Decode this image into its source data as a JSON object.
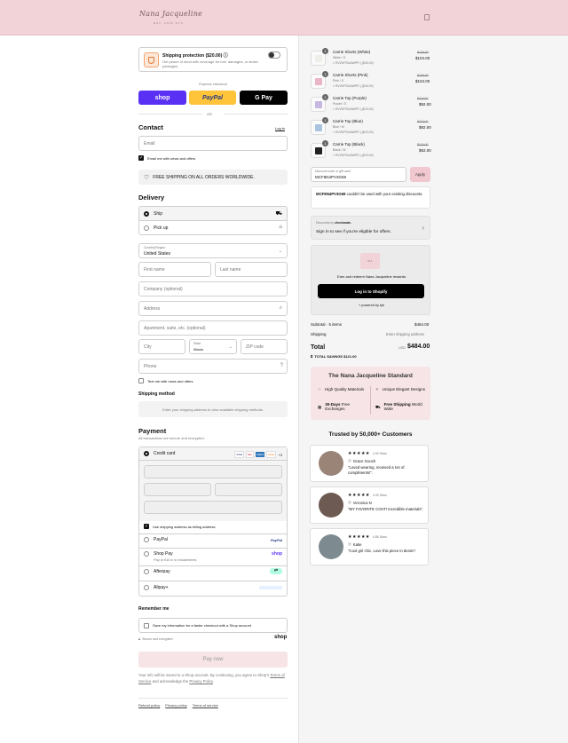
{
  "header": {
    "logo": "Nana Jacqueline",
    "logo_sub": "EST. 2016 NYC"
  },
  "protection": {
    "title": "Shipping protection ($20.00) ⓘ",
    "desc": "Get peace of mind with coverage for lost, damaged, or stolen packages."
  },
  "express": {
    "label": "Express checkout",
    "shop": "shop",
    "paypal": "PayPal",
    "gpay": "G Pay",
    "or": "OR"
  },
  "contact": {
    "title": "Contact",
    "login": "Log in",
    "email_placeholder": "Email",
    "news": "Email me with news and offers"
  },
  "banner": "FREE SHIPPING ON ALL ORDERS WORLDWIDE.",
  "delivery": {
    "title": "Delivery",
    "ship": "Ship",
    "pickup": "Pick up",
    "country_label": "Country/Region",
    "country": "United States",
    "first": "First name",
    "last": "Last name",
    "company": "Company (optional)",
    "address": "Address",
    "apt": "Apartment, suite, etc. (optional)",
    "city": "City",
    "state_label": "State",
    "state": "Illinois",
    "zip": "ZIP code",
    "phone": "Phone",
    "text_me": "Text me with news and offers"
  },
  "shipping_method": {
    "title": "Shipping method",
    "note": "Enter your shipping address to view available shipping methods."
  },
  "payment": {
    "title": "Payment",
    "sub": "All transactions are secure and encrypted.",
    "credit": "Credit card",
    "cards": [
      "VISA",
      "MC",
      "AMEX",
      "DISC"
    ],
    "more": "+3",
    "billing": "Use shipping address as billing address",
    "paypal": "PayPal",
    "paypal_logo": "PayPal",
    "shoppay": "Shop Pay",
    "shoppay_sub": "Pay in full or in installments",
    "shoppay_logo": "shop",
    "afterpay": "Afterpay",
    "alipay": "Alipay+"
  },
  "remember": {
    "title": "Remember me",
    "save": "Save my information for a faster checkout with a Shop account",
    "secure": "Secure and encrypted",
    "shop": "shop"
  },
  "pay_now": "Pay now",
  "legal": {
    "text1": "Your info will be saved to a Shop account. By continuing, you agree to Shop's",
    "tos": "Terms of Service",
    "and": "and acknowledge the",
    "privacy": "Privacy Policy",
    "end": "."
  },
  "footer": {
    "refund": "Refund policy",
    "privacy": "Privacy policy",
    "terms": "Terms of service"
  },
  "items": [
    {
      "name": "Carrie Shorts (White)",
      "variant": "White / S",
      "discount": "RVZKPSUAWPR | ($26.00)",
      "old": "$130.00",
      "price": "$104.00",
      "qty": "1",
      "color": "#efefe9"
    },
    {
      "name": "Carrie Shorts (Pink)",
      "variant": "Pink / S",
      "discount": "RVZKPSUAWPR | ($26.00)",
      "old": "$130.00",
      "price": "$104.00",
      "qty": "1",
      "color": "#e8b6c4"
    },
    {
      "name": "Carrie Top (Purple)",
      "variant": "Purple / S",
      "discount": "RVZKPSUAWPR | ($23.00)",
      "old": "$115.00",
      "price": "$92.00",
      "qty": "1",
      "color": "#c7b8e0"
    },
    {
      "name": "Carrie Top (Blue)",
      "variant": "Blue / M",
      "discount": "RVZKPSUAWPR | ($23.00)",
      "old": "$115.00",
      "price": "$92.00",
      "qty": "1",
      "color": "#a9c4de"
    },
    {
      "name": "Carrie Top (Black)",
      "variant": "Black / M",
      "discount": "RVZKPSUAWPR | ($23.00)",
      "old": "$115.00",
      "price": "$92.00",
      "qty": "1",
      "color": "#222222"
    }
  ],
  "code": {
    "label": "Discount code or gift card",
    "value": "MCF8N4PV3G69",
    "apply": "Apply",
    "error_code": "MCF8N4PV3G69",
    "error_rest": "couldn't be used with your existing discounts."
  },
  "checkmate": {
    "label": "Discounts by",
    "brand": "checkmate.",
    "cta": "Sign in to see if you're eligible for offers."
  },
  "rewards": {
    "text": "Earn and redeem Nana Jacqueline rewards",
    "button": "Log in to Shopify",
    "powered": "+ powered by tyb"
  },
  "totals": {
    "subtotal_label": "Subtotal · 5 items",
    "subtotal": "$484.00",
    "shipping_label": "Shipping",
    "shipping": "Enter shipping address",
    "total_label": "Total",
    "currency": "USD",
    "total": "$484.00",
    "savings": "TOTAL SAVINGS $121.00"
  },
  "standard": {
    "title": "The Nana Jacqueline Standard",
    "f1": "High Quality Materials",
    "f2": "Unique Elegant Designs",
    "f3a": "30-Days",
    "f3b": "Free Exchanges",
    "f4a": "Free Shipping",
    "f4b": "World Wide"
  },
  "trusted": "Trusted by 50,000+ Customers",
  "reviews": [
    {
      "stars": "★★★★★",
      "ago": "4.90 Stars",
      "name": "Grace Gooch",
      "text": "\"Loved wearing, received a ton of compliments!\"."
    },
    {
      "stars": "★★★★★",
      "ago": "4.90 Stars",
      "name": "Veronica N",
      "text": "\"MY FAVORITE COAT! Incredible materials\"."
    },
    {
      "stars": "★★★★★",
      "ago": "4.85 Stars",
      "name": "Katie",
      "text": "\"Cool girl chic. Love this piece in denim\"."
    }
  ],
  "colors": {
    "accent": "#f1d3d8",
    "pay_now": "#f6e4e7",
    "shop": "#5a31f4",
    "paypal": "#ffc439",
    "apply": "#f1c8cf"
  }
}
